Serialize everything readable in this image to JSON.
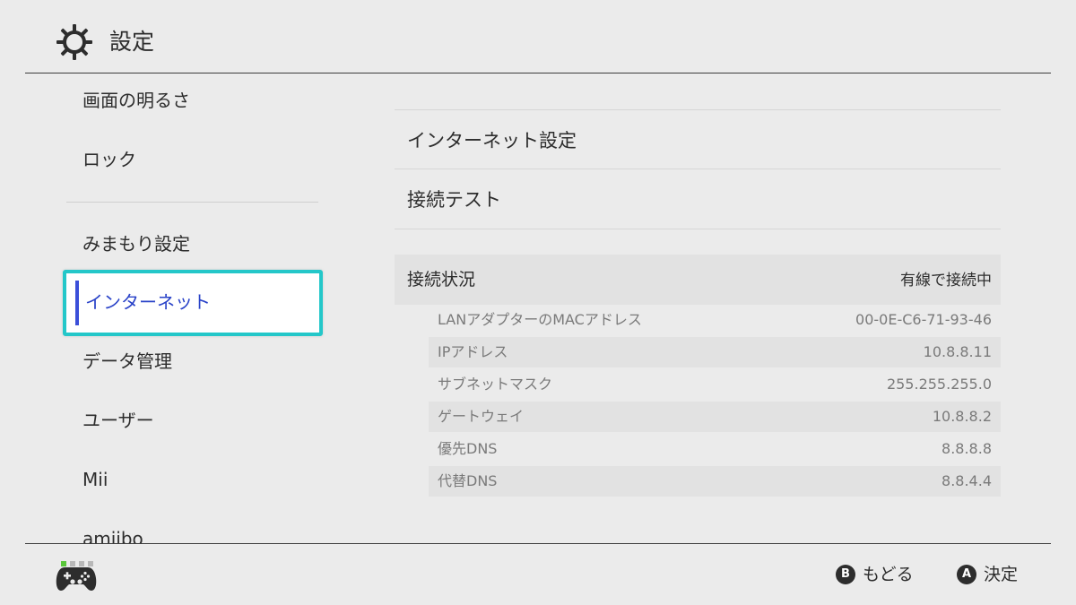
{
  "header": {
    "title": "設定",
    "icon": "gear-icon"
  },
  "sidebar": {
    "items": [
      {
        "label": "画面の明るさ"
      },
      {
        "label": "ロック"
      },
      {
        "label": "みまもり設定"
      },
      {
        "label": "インターネット",
        "selected": true
      },
      {
        "label": "データ管理"
      },
      {
        "label": "ユーザー"
      },
      {
        "label": "Mii"
      },
      {
        "label": "amiibo"
      }
    ],
    "accent_color": "#24c7c9",
    "selected_text_color": "#2a43c8"
  },
  "main": {
    "options": [
      {
        "label": "インターネット設定"
      },
      {
        "label": "接続テスト"
      }
    ],
    "status": {
      "label": "接続状況",
      "value": "有線で接続中"
    },
    "details": [
      {
        "key": "LANアダプターのMACアドレス",
        "value": "00-0E-C6-71-93-46"
      },
      {
        "key": "IPアドレス",
        "value": "10.8.8.11"
      },
      {
        "key": "サブネットマスク",
        "value": "255.255.255.0"
      },
      {
        "key": "ゲートウェイ",
        "value": "10.8.8.2"
      },
      {
        "key": "優先DNS",
        "value": "8.8.8.8"
      },
      {
        "key": "代替DNS",
        "value": "8.8.4.4"
      }
    ]
  },
  "footer": {
    "back": {
      "button": "B",
      "label": "もどる"
    },
    "confirm": {
      "button": "A",
      "label": "決定"
    },
    "controller_icon": "controller-icon",
    "player_indicator_color": "#59c73a"
  }
}
